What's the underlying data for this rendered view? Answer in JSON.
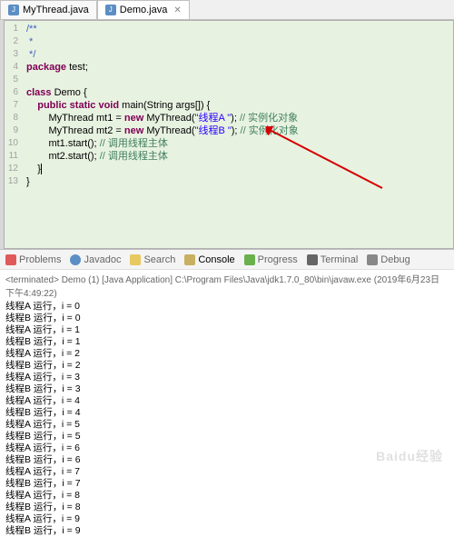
{
  "tabs": [
    {
      "label": "MyThread.java",
      "active": false
    },
    {
      "label": "Demo.java",
      "active": true
    }
  ],
  "code_lines": [
    {
      "n": 1,
      "html": "<span class='jdoc'>/**</span>"
    },
    {
      "n": 2,
      "html": "<span class='jdoc'> *</span>"
    },
    {
      "n": 3,
      "html": "<span class='jdoc'> */</span>"
    },
    {
      "n": 4,
      "html": "<span class='kw'>package</span> test;"
    },
    {
      "n": 5,
      "html": ""
    },
    {
      "n": 6,
      "html": "<span class='kw'>class</span> Demo {"
    },
    {
      "n": 7,
      "html": "    <span class='kw'>public static void</span> main(String args[]) {"
    },
    {
      "n": 8,
      "html": "        MyThread mt1 = <span class='kw'>new</span> MyThread(<span class='str'>\"线程A \"</span>); <span class='cmt'>// 实例化对象</span>"
    },
    {
      "n": 9,
      "html": "        MyThread mt2 = <span class='kw'>new</span> MyThread(<span class='str'>\"线程B \"</span>); <span class='cmt'>// 实例化对象</span>"
    },
    {
      "n": 10,
      "html": "        mt1.start(); <span class='cmt'>// 调用线程主体</span>"
    },
    {
      "n": 11,
      "html": "        mt2.start(); <span class='cmt'>// 调用线程主体</span>"
    },
    {
      "n": 12,
      "html": "    }<span class='cursor'></span>"
    },
    {
      "n": 13,
      "html": "}"
    }
  ],
  "bottom_views": [
    {
      "name": "Problems",
      "iconClass": "prob"
    },
    {
      "name": "Javadoc",
      "iconClass": "jdoc"
    },
    {
      "name": "Search",
      "iconClass": "search"
    },
    {
      "name": "Console",
      "iconClass": "console",
      "active": true
    },
    {
      "name": "Progress",
      "iconClass": "progress"
    },
    {
      "name": "Terminal",
      "iconClass": "term"
    },
    {
      "name": "Debug",
      "iconClass": "debug"
    }
  ],
  "console_header": "<terminated> Demo (1) [Java Application] C:\\Program Files\\Java\\jdk1.7.0_80\\bin\\javaw.exe (2019年6月23日 下午4:49:22)",
  "console_output": [
    "线程A 运行，i = 0",
    "线程B 运行，i = 0",
    "线程A 运行，i = 1",
    "线程B 运行，i = 1",
    "线程A 运行，i = 2",
    "线程B 运行，i = 2",
    "线程A 运行，i = 3",
    "线程B 运行，i = 3",
    "线程A 运行，i = 4",
    "线程B 运行，i = 4",
    "线程A 运行，i = 5",
    "线程B 运行，i = 5",
    "线程A 运行，i = 6",
    "线程B 运行，i = 6",
    "线程A 运行，i = 7",
    "线程B 运行，i = 7",
    "线程A 运行，i = 8",
    "线程B 运行，i = 8",
    "线程A 运行，i = 9",
    "线程B 运行，i = 9"
  ],
  "watermark": "Baidu经验"
}
